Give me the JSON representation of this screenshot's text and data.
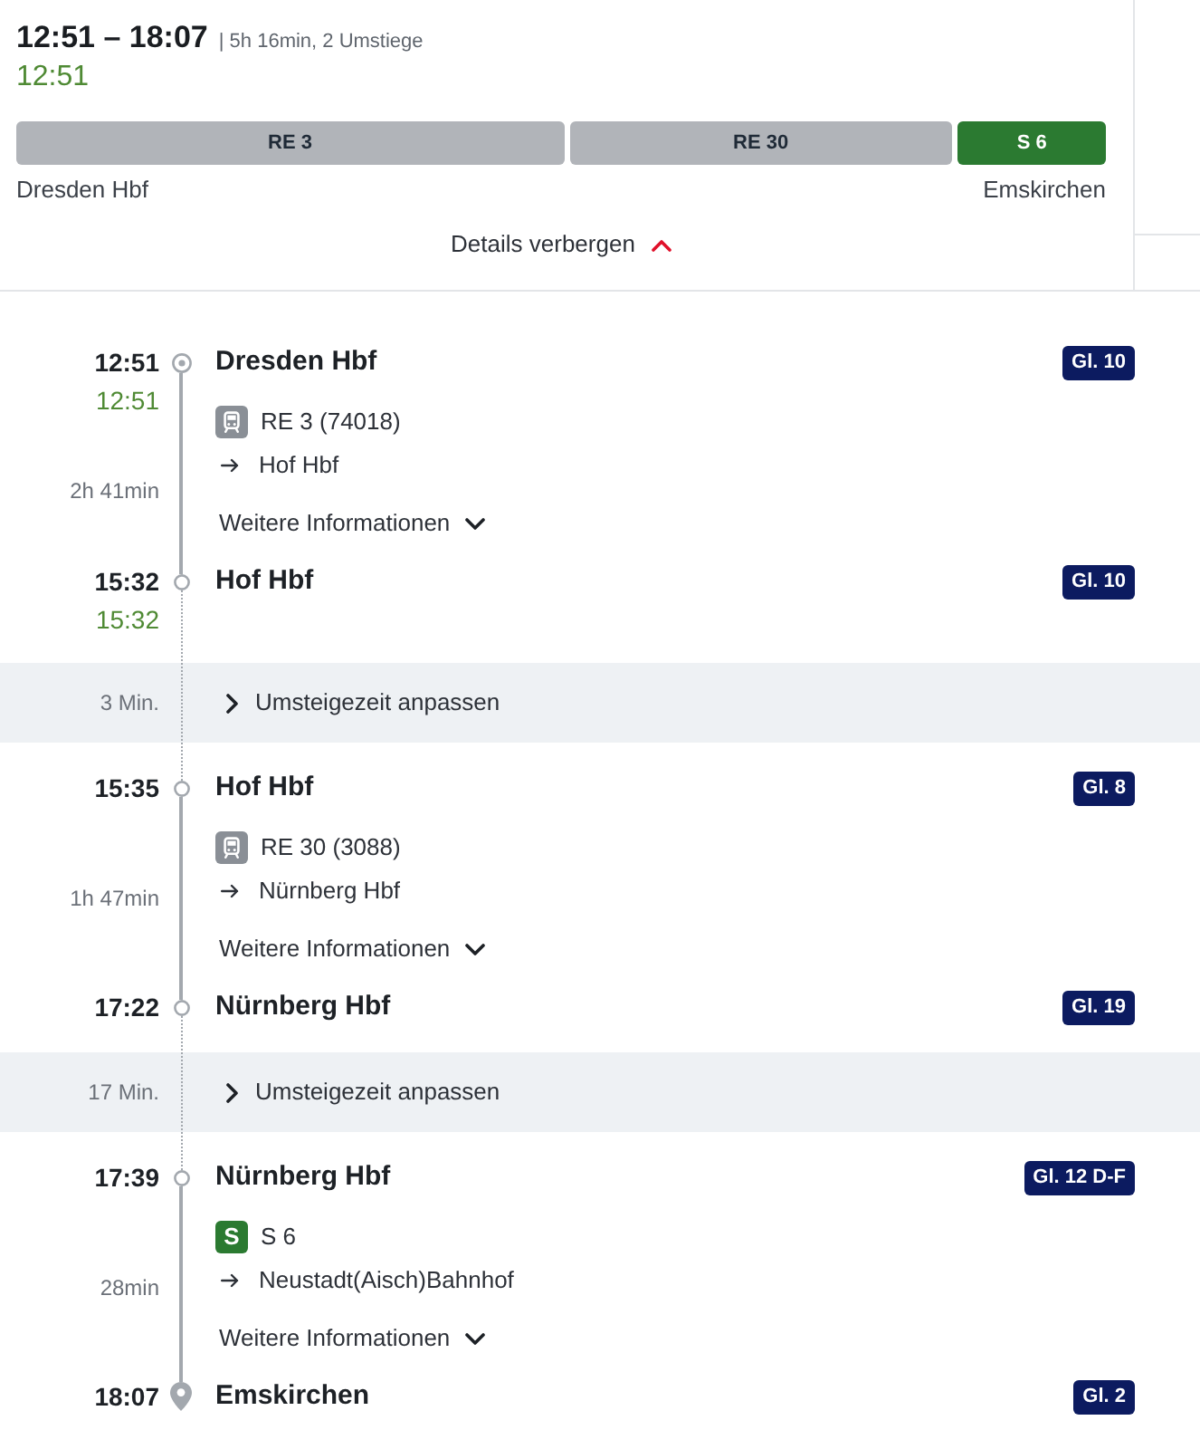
{
  "summary": {
    "time_range": "12:51 – 18:07",
    "info": "| 5h 16min, 2 Umstiege",
    "realtime": "12:51"
  },
  "segments": [
    {
      "label": "RE 3",
      "kind": "regional",
      "color": "#b1b4b9"
    },
    {
      "label": "RE 30",
      "kind": "regional",
      "color": "#b1b4b9"
    },
    {
      "label": "S 6",
      "kind": "sbahn",
      "color": "#2b7a31"
    }
  ],
  "origin": "Dresden Hbf",
  "destination": "Emskirchen",
  "details_toggle": {
    "label": "Details verbergen",
    "expanded": true
  },
  "timeline": [
    {
      "kind": "leg",
      "departure": {
        "kind": "origin",
        "time": "12:51",
        "realtime": "12:51",
        "station": "Dresden Hbf",
        "platform": "Gl. 10"
      },
      "train": {
        "kind": "regional",
        "name": "RE 3 (74018)"
      },
      "direction": "Hof Hbf",
      "duration": "2h 41min",
      "more_info": {
        "label": "Weitere Informationen",
        "expanded": false
      },
      "arrival": {
        "kind": "stop",
        "time": "15:32",
        "realtime": "15:32",
        "station": "Hof Hbf",
        "platform": "Gl. 10"
      }
    },
    {
      "kind": "transfer",
      "duration": "3 Min.",
      "action": {
        "label": "Umsteigezeit anpassen",
        "expanded": false
      }
    },
    {
      "kind": "leg",
      "departure": {
        "kind": "stop",
        "time": "15:35",
        "station": "Hof Hbf",
        "platform": "Gl. 8"
      },
      "train": {
        "kind": "regional",
        "name": "RE 30 (3088)"
      },
      "direction": "Nürnberg Hbf",
      "duration": "1h 47min",
      "more_info": {
        "label": "Weitere Informationen",
        "expanded": false
      },
      "arrival": {
        "kind": "stop",
        "time": "17:22",
        "station": "Nürnberg Hbf",
        "platform": "Gl. 19"
      }
    },
    {
      "kind": "transfer",
      "duration": "17 Min.",
      "action": {
        "label": "Umsteigezeit anpassen",
        "expanded": false
      }
    },
    {
      "kind": "leg",
      "departure": {
        "kind": "stop",
        "time": "17:39",
        "station": "Nürnberg Hbf",
        "platform": "Gl. 12 D-F"
      },
      "train": {
        "kind": "sbahn",
        "logo": "S",
        "name": "S 6"
      },
      "direction": "Neustadt(Aisch)Bahnhof",
      "duration": "28min",
      "more_info": {
        "label": "Weitere Informationen",
        "expanded": false
      },
      "arrival": {
        "kind": "destination",
        "time": "18:07",
        "station": "Emskirchen",
        "platform": "Gl. 2"
      }
    }
  ]
}
